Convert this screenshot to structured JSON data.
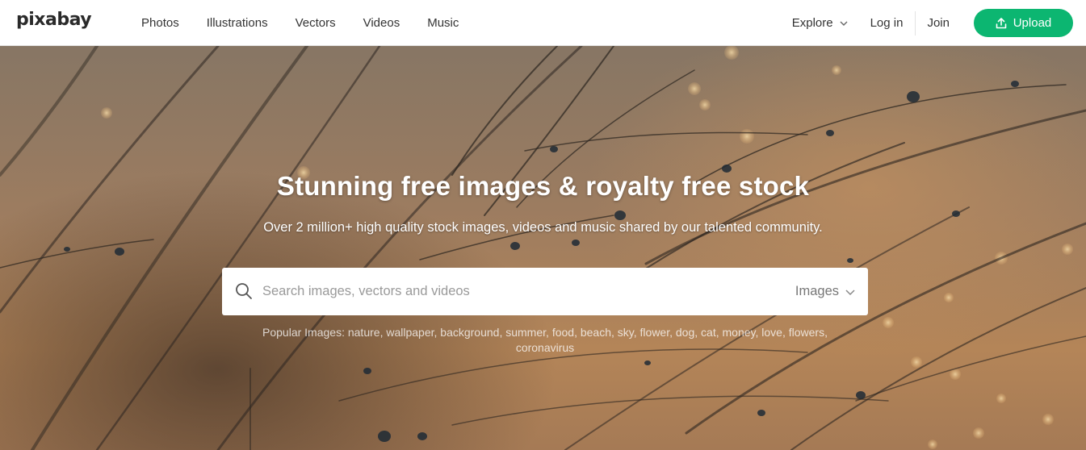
{
  "header": {
    "logo": "pixabay",
    "nav": [
      "Photos",
      "Illustrations",
      "Vectors",
      "Videos",
      "Music"
    ],
    "explore_label": "Explore",
    "login_label": "Log in",
    "join_label": "Join",
    "upload_label": "Upload"
  },
  "hero": {
    "title": "Stunning free images & royalty free stock",
    "subtitle": "Over 2 million+ high quality stock images, videos and music shared by our talented community."
  },
  "search": {
    "placeholder": "Search images, vectors and videos",
    "value": "",
    "type_selected": "Images"
  },
  "popular": {
    "label": "Popular Images:",
    "tags": [
      "nature",
      "wallpaper",
      "background",
      "summer",
      "food",
      "beach",
      "sky",
      "flower",
      "dog",
      "cat",
      "money",
      "love",
      "flowers",
      "coronavirus"
    ]
  },
  "colors": {
    "accent": "#0cb671",
    "header_bg": "#ffffff",
    "text": "#333333"
  },
  "icons": {
    "upload": "upload-icon",
    "search": "search-icon",
    "chevron": "chevron-down-icon"
  }
}
